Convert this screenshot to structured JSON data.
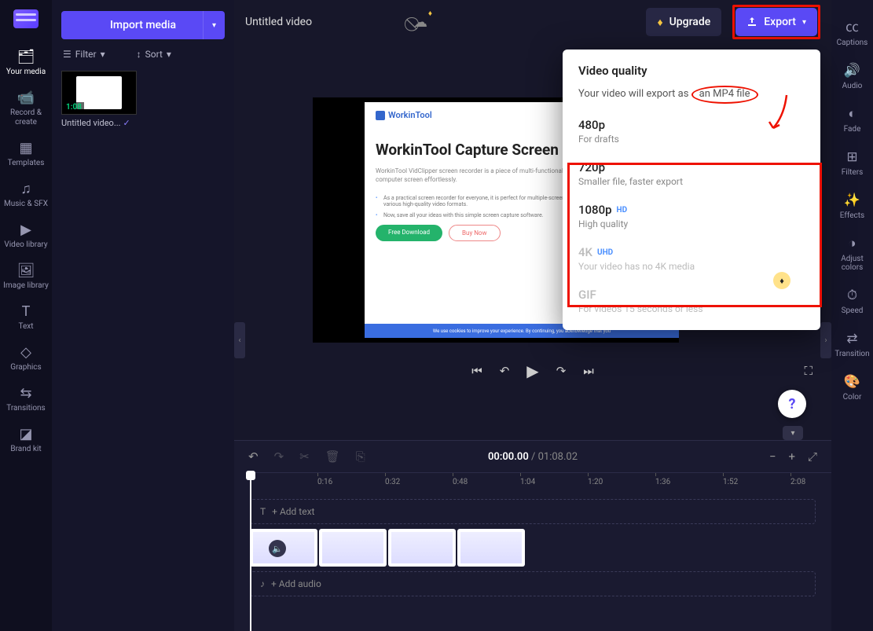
{
  "leftNav": {
    "items": [
      {
        "label": "Your media",
        "icon": "folder"
      },
      {
        "label": "Record & create",
        "icon": "camera"
      },
      {
        "label": "Templates",
        "icon": "grid"
      },
      {
        "label": "Music & SFX",
        "icon": "music"
      },
      {
        "label": "Video library",
        "icon": "video"
      },
      {
        "label": "Image library",
        "icon": "image"
      },
      {
        "label": "Text",
        "icon": "text"
      },
      {
        "label": "Graphics",
        "icon": "shapes"
      },
      {
        "label": "Transitions",
        "icon": "transition"
      },
      {
        "label": "Brand kit",
        "icon": "brand"
      }
    ],
    "activeIndex": 0
  },
  "mediaPanel": {
    "importLabel": "Import media",
    "filterLabel": "Filter",
    "sortLabel": "Sort",
    "clip": {
      "name": "Untitled video...",
      "duration": "1:08",
      "used": true
    }
  },
  "topbar": {
    "title": "Untitled video",
    "upgradeLabel": "Upgrade",
    "exportLabel": "Export"
  },
  "preview": {
    "brand": "WorkinTool",
    "headline": "WorkinTool Capture Screen",
    "sub": "WorkinTool VidClipper screen recorder is a piece of multi-functional screen software able to capture your computer screen effortlessly.",
    "bullets": [
      "As a practical screen recorder for everyone, it is perfect for multiple-screen allows you to export your recordings in various high-quality video formats.",
      "Now, save all your ideas with this simple screen capture software."
    ],
    "btn1": "Free Download",
    "btn2": "Buy Now",
    "banner": "We use cookies to improve your experience. By continuing, you acknowledge that you"
  },
  "exportDropdown": {
    "title": "Video quality",
    "subtitle_prefix": "Your video will export as ",
    "subtitle_highlight": "an MP4 file",
    "options": [
      {
        "title": "480p",
        "desc": "For drafts",
        "badge": "",
        "disabled": false
      },
      {
        "title": "720p",
        "desc": "Smaller file, faster export",
        "badge": "",
        "disabled": false
      },
      {
        "title": "1080p",
        "desc": "High quality",
        "badge": "HD",
        "disabled": false
      },
      {
        "title": "4K",
        "desc": "Your video has no 4K media",
        "badge": "UHD",
        "disabled": true,
        "premium": true
      },
      {
        "title": "GIF",
        "desc": "For videos 15 seconds or less",
        "badge": "",
        "disabled": true
      }
    ]
  },
  "playback": {
    "current": "00:00.00",
    "total": "01:08.02"
  },
  "timeline": {
    "ticks": [
      "0:16",
      "0:32",
      "0:48",
      "1:04",
      "1:20",
      "1:36",
      "1:52",
      "2:08"
    ],
    "addTextLabel": "+ Add text",
    "addAudioLabel": "+ Add audio",
    "clipCount": 4
  },
  "rightTools": {
    "items": [
      {
        "label": "Captions",
        "icon": "cc"
      },
      {
        "label": "Audio",
        "icon": "speaker"
      },
      {
        "label": "Fade",
        "icon": "fade"
      },
      {
        "label": "Filters",
        "icon": "filters"
      },
      {
        "label": "Effects",
        "icon": "wand"
      },
      {
        "label": "Adjust colors",
        "icon": "contrast"
      },
      {
        "label": "Speed",
        "icon": "gauge"
      },
      {
        "label": "Transition",
        "icon": "trans"
      },
      {
        "label": "Color",
        "icon": "palette"
      }
    ]
  }
}
